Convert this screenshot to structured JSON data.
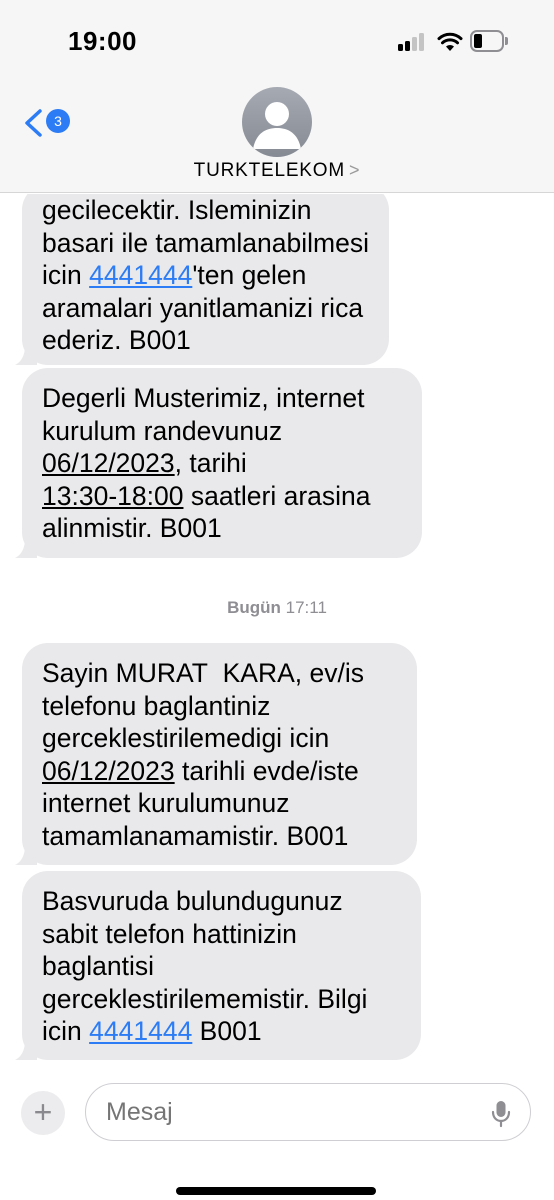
{
  "status_bar": {
    "time": "19:00"
  },
  "header": {
    "unread_count": "3",
    "contact_name": "TURKTELEKOM",
    "contact_chevron": ">"
  },
  "thread": {
    "messages": [
      {
        "lines": [
          [
            "gecilecektir. Isleminizin"
          ],
          [
            "basari ile tamamlanabilmesi"
          ],
          [
            "icin ",
            {
              "link": "4441444"
            },
            "'ten gelen"
          ],
          [
            "aramalari yanitlamanizi rica"
          ],
          [
            "ederiz. B001"
          ]
        ]
      },
      {
        "lines": [
          [
            "Degerli Musterimiz, internet"
          ],
          [
            "kurulum randevunuz"
          ],
          [
            {
              "u": "06/12/2023"
            },
            ", tarihi"
          ],
          [
            {
              "u": "13:30-18:00"
            },
            " saatleri arasina"
          ],
          [
            "alinmistir. B001"
          ]
        ]
      },
      {
        "lines": [
          [
            "Sayin MURAT  KARA, ev/is"
          ],
          [
            "telefonu baglantiniz"
          ],
          [
            "gerceklestirilemedigi icin"
          ],
          [
            {
              "u": "06/12/2023"
            },
            " tarihli evde/iste"
          ],
          [
            "internet kurulumunuz"
          ],
          [
            "tamamlanamamistir. B001"
          ]
        ]
      },
      {
        "lines": [
          [
            "Basvuruda bulundugunuz"
          ],
          [
            "sabit telefon hattinizin"
          ],
          [
            "baglantisi"
          ],
          [
            "gerceklestirilememistir. Bilgi"
          ],
          [
            "icin ",
            {
              "link": "4441444"
            },
            " B001"
          ]
        ]
      }
    ],
    "timestamp_day": "Bugün",
    "timestamp_time": "17:11"
  },
  "compose": {
    "plus": "+",
    "placeholder": "Mesaj"
  },
  "colors": {
    "link": "#2c7cf5",
    "bubble": "#e9e9eb",
    "badge": "#2c7cf5"
  }
}
